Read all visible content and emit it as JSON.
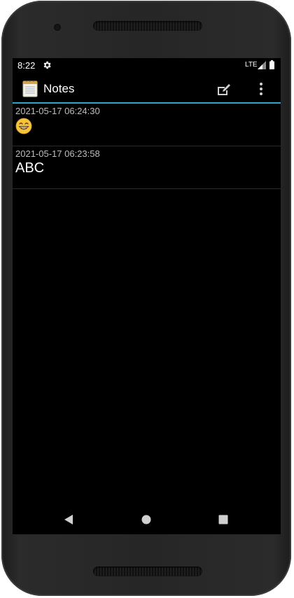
{
  "status_bar": {
    "time": "8:22",
    "network": "LTE",
    "settings_icon": "gear-icon",
    "signal_icon": "signal-icon",
    "battery_icon": "battery-icon"
  },
  "action_bar": {
    "title": "Notes",
    "app_icon": "notepad-icon",
    "new_note_icon": "edit-note-icon",
    "overflow_icon": "more-vert-icon",
    "accent_color": "#33a3c9"
  },
  "notes": [
    {
      "date": "2021-05-17 06:24:30",
      "body": "😁"
    },
    {
      "date": "2021-05-17 06:23:58",
      "body": "ABC"
    }
  ],
  "nav_bar": {
    "back_icon": "back-triangle-icon",
    "home_icon": "home-circle-icon",
    "recents_icon": "recents-square-icon"
  }
}
